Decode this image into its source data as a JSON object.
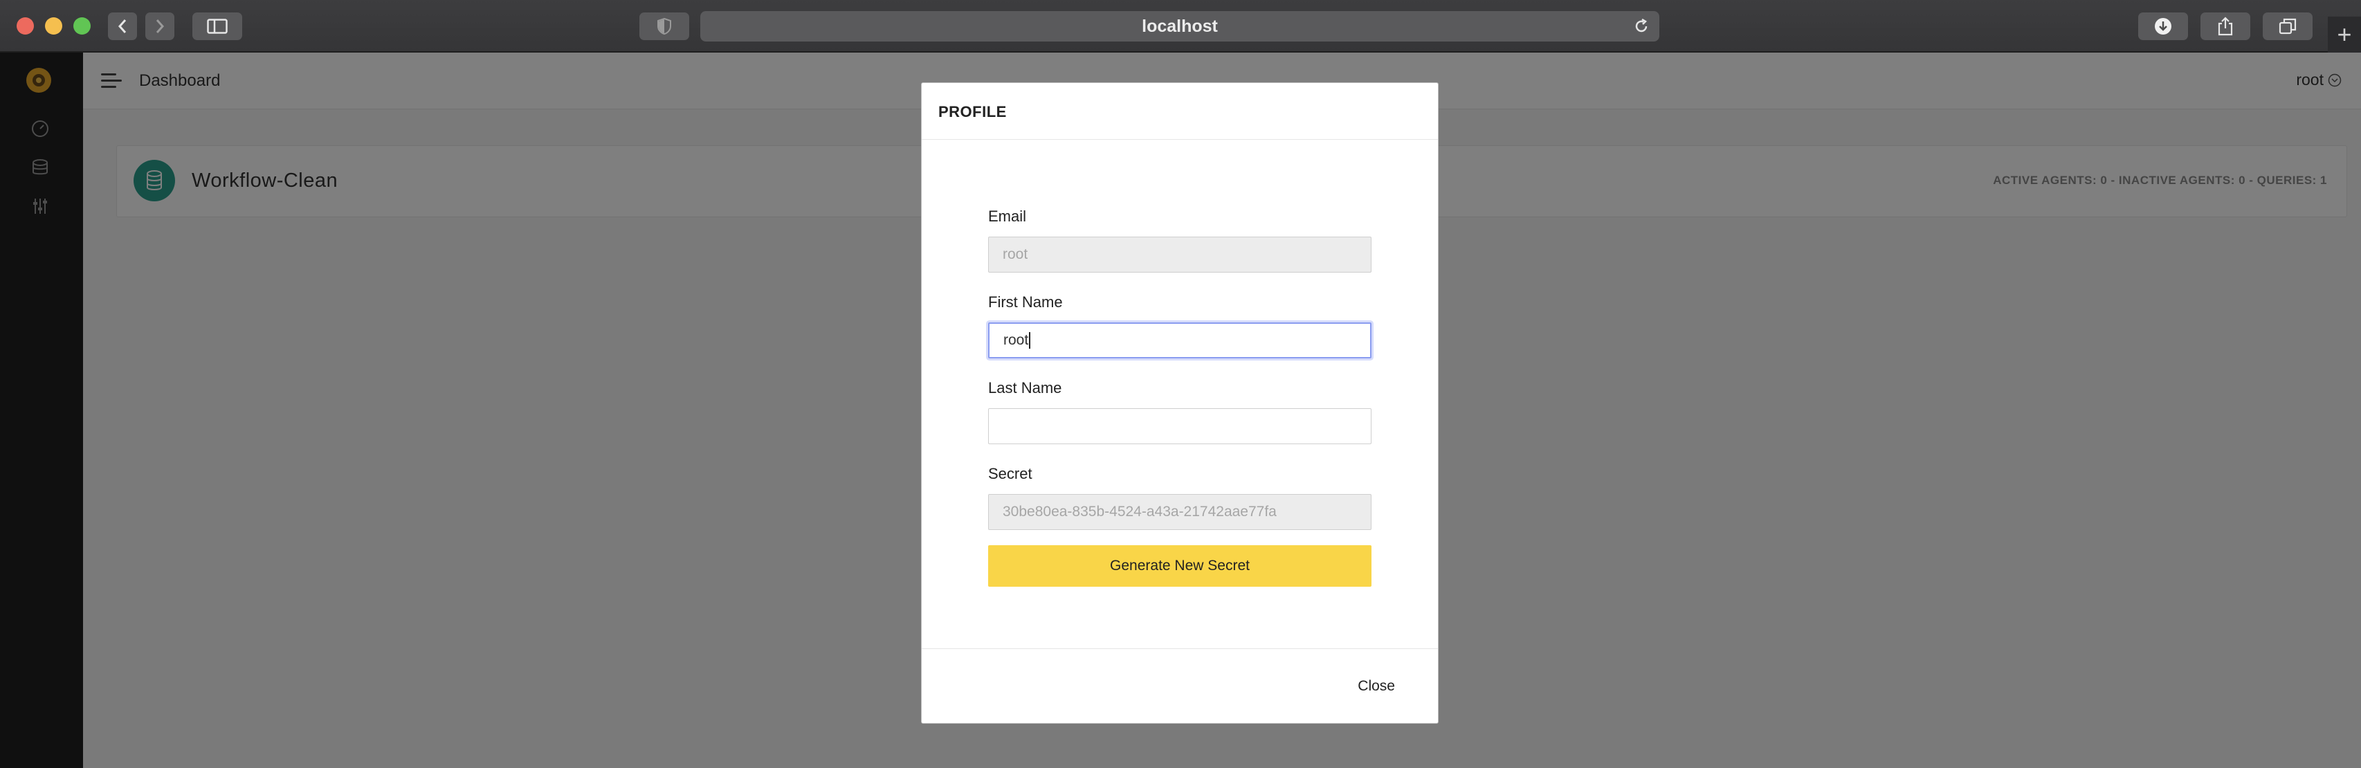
{
  "browser": {
    "url": "localhost"
  },
  "app": {
    "header": {
      "title": "Dashboard",
      "user": "root"
    },
    "environment_card": {
      "name": "Workflow-Clean",
      "stats": "ACTIVE AGENTS: 0 - INACTIVE AGENTS: 0 - QUERIES: 1"
    }
  },
  "modal": {
    "title": "PROFILE",
    "fields": {
      "email": {
        "label": "Email",
        "value": "root"
      },
      "first_name": {
        "label": "First Name",
        "value": "root"
      },
      "last_name": {
        "label": "Last Name",
        "value": ""
      },
      "secret": {
        "label": "Secret",
        "value": "30be80ea-835b-4524-a43a-21742aae77fa"
      }
    },
    "generate_label": "Generate New Secret",
    "close_label": "Close"
  },
  "colors": {
    "accent_button": "#f9d548",
    "card_icon": "#2a9f8c",
    "focus_ring": "#8a9cf0",
    "sidebar": "#202020"
  }
}
